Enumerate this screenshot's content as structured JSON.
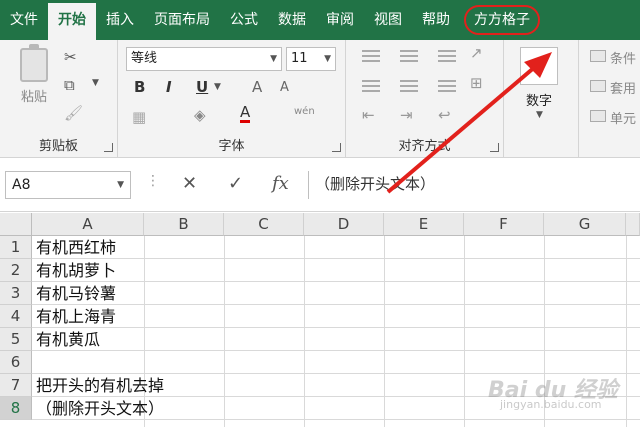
{
  "menu": {
    "tabs": [
      "文件",
      "开始",
      "插入",
      "页面布局",
      "公式",
      "数据",
      "审阅",
      "视图",
      "帮助"
    ],
    "active_index": 1,
    "addin_tab": "方方格子"
  },
  "ribbon": {
    "clipboard": {
      "paste_label": "粘贴",
      "group_label": "剪贴板"
    },
    "font": {
      "font_name": "等线",
      "font_size": "11",
      "group_label": "字体",
      "bold": "B",
      "italic": "I",
      "underline": "U",
      "grow": "A",
      "shrink": "A",
      "color_a": "A",
      "phonetic": "wén"
    },
    "alignment": {
      "group_label": "对齐方式"
    },
    "number": {
      "format_icon": "%",
      "label": "数字"
    },
    "styles": {
      "items": [
        "条件",
        "套用",
        "单元"
      ]
    }
  },
  "formula_bar": {
    "name_box": "A8",
    "cancel": "✕",
    "enter": "✓",
    "fx": "fx",
    "content": "（删除开头文本）"
  },
  "grid": {
    "columns": [
      "A",
      "B",
      "C",
      "D",
      "E",
      "F",
      "G"
    ],
    "rows": [
      "1",
      "2",
      "3",
      "4",
      "5",
      "6",
      "7",
      "8"
    ],
    "cells_a": [
      "有机西红柿",
      "有机胡萝卜",
      "有机马铃薯",
      "有机上海青",
      "有机黄瓜",
      "",
      "把开头的有机去掉",
      "（删除开头文本）"
    ],
    "selected_row": "8"
  },
  "watermark": {
    "main": "Bai du 经验",
    "sub": "jingyan.baidu.com"
  },
  "colors": {
    "excel_green": "#217346",
    "annotation_red": "#e2211c"
  }
}
